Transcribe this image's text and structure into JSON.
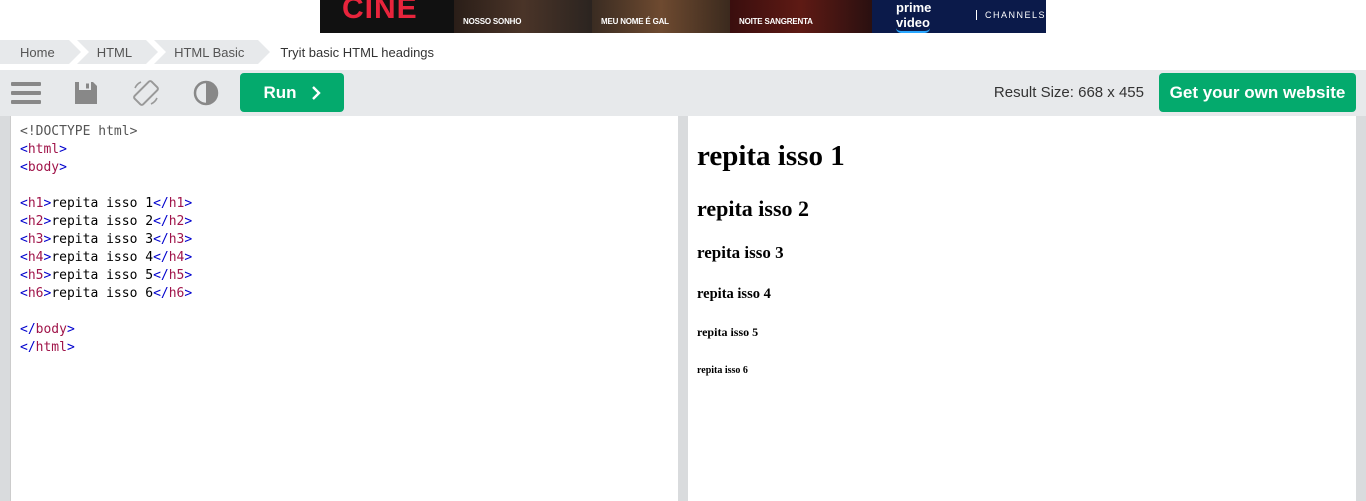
{
  "ad": {
    "brand": "CINE",
    "movies": [
      "NOSSO SONHO",
      "MEU NOME É GAL",
      "NOITE SANGRENTA"
    ],
    "prime_label": "prime video",
    "prime_channels": "CHANNELS"
  },
  "breadcrumb": {
    "items": [
      "Home",
      "HTML",
      "HTML Basic"
    ],
    "current": "Tryit basic HTML headings"
  },
  "toolbar": {
    "run_label": "Run",
    "result_size": "Result Size: 668 x 455",
    "get_website_label": "Get your own website",
    "icons": [
      "menu-icon",
      "save-icon",
      "rotate-icon",
      "contrast-icon"
    ]
  },
  "colors": {
    "accent": "#04aa6d",
    "toolbar_bg": "#e7e9eb",
    "tag": "#a0154a",
    "bracket": "#0000cd"
  },
  "code": {
    "doctype": "<!DOCTYPE html>",
    "html_tag": "html",
    "body_tag": "body",
    "headings": [
      {
        "tag": "h1",
        "text": "repita isso 1"
      },
      {
        "tag": "h2",
        "text": "repita isso 2"
      },
      {
        "tag": "h3",
        "text": "repita isso 3"
      },
      {
        "tag": "h4",
        "text": "repita isso 4"
      },
      {
        "tag": "h5",
        "text": "repita isso 5"
      },
      {
        "tag": "h6",
        "text": "repita isso 6"
      }
    ]
  },
  "result": {
    "h1": "repita isso 1",
    "h2": "repita isso 2",
    "h3": "repita isso 3",
    "h4": "repita isso 4",
    "h5": "repita isso 5",
    "h6": "repita isso 6"
  }
}
